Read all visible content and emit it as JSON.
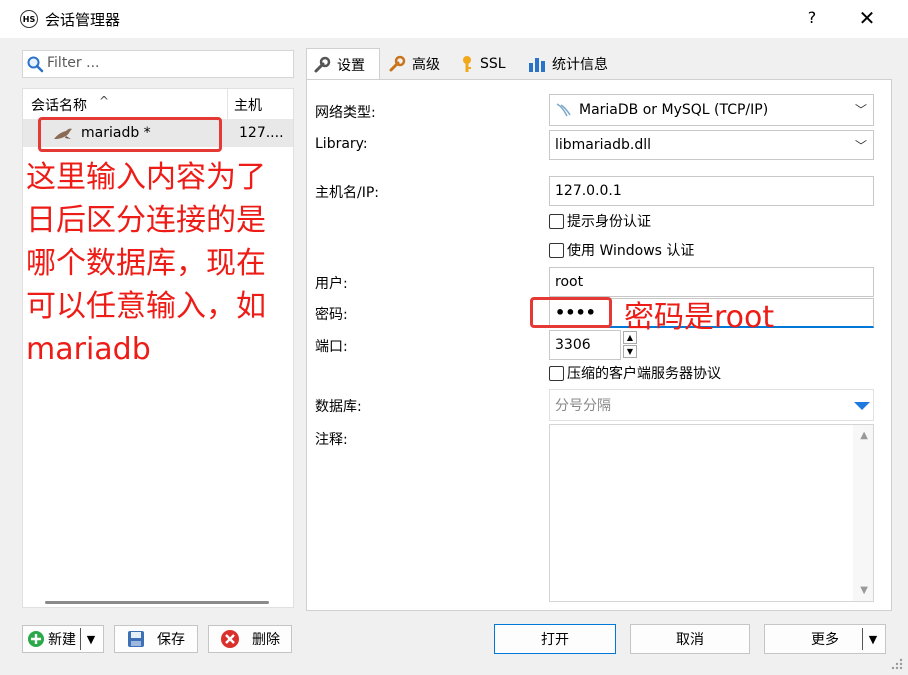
{
  "window": {
    "title": "会话管理器",
    "app_icon_label": "HS",
    "help_label": "?",
    "close_label": "✕"
  },
  "filter": {
    "placeholder": "Filter ..."
  },
  "session_list": {
    "columns": [
      {
        "label": "会话名称",
        "sort_indicator": "^"
      },
      {
        "label": "主机"
      }
    ],
    "rows": [
      {
        "name": "mariadb *",
        "host": "127....",
        "icon": "seal-icon",
        "selected": true
      }
    ]
  },
  "annotations": {
    "left_note": "这里输入内容为了日后区分连接的是哪个数据库，现在可以任意输入，如mariadb",
    "password_note": "密码是root",
    "color": "#ee1c16"
  },
  "tabs": [
    {
      "label": "设置",
      "icon": "wrench-icon",
      "active": true
    },
    {
      "label": "高级",
      "icon": "wrench-orange-icon",
      "active": false
    },
    {
      "label": "SSL",
      "icon": "key-icon",
      "active": false
    },
    {
      "label": "统计信息",
      "icon": "bar-chart-icon",
      "active": false
    }
  ],
  "settings": {
    "network_type_label": "网络类型:",
    "network_type_value": "MariaDB or MySQL (TCP/IP)",
    "library_label": "Library:",
    "library_value": "libmariadb.dll",
    "host_label": "主机名/IP:",
    "host_value": "127.0.0.1",
    "prompt_credentials_label": "提示身份认证",
    "use_windows_auth_label": "使用 Windows 认证",
    "user_label": "用户:",
    "user_value": "root",
    "password_label": "密码:",
    "password_value": "••••",
    "port_label": "端口:",
    "port_value": "3306",
    "compressed_label": "压缩的客户端服务器协议",
    "database_label": "数据库:",
    "database_placeholder": "分号分隔",
    "comment_label": "注释:"
  },
  "bottom": {
    "new_label": "新建",
    "save_label": "保存",
    "delete_label": "删除",
    "open_label": "打开",
    "cancel_label": "取消",
    "more_label": "更多"
  },
  "colors": {
    "accent_blue": "#0078d7",
    "new_green": "#2aa84a",
    "delete_red": "#d9302c",
    "annotation_red": "#e53935"
  }
}
